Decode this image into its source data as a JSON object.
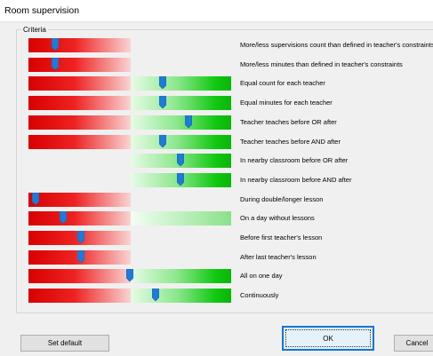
{
  "window": {
    "title": "Room supervision"
  },
  "criteria_group": {
    "label": "Criteria"
  },
  "colors": {
    "thumb": "#1e7bd8",
    "ok_border": "#0078d7"
  },
  "criteria": [
    {
      "label": "More/less supervisions count than defined in teacher's constraints",
      "value": 0.12,
      "has_red": true,
      "has_green": false
    },
    {
      "label": "More/less minutes than defined in teacher's constraints",
      "value": 0.12,
      "has_red": true,
      "has_green": false
    },
    {
      "label": "Equal count for each teacher",
      "value": 0.67,
      "has_red": true,
      "has_green": true
    },
    {
      "label": "Equal minutes for each teacher",
      "value": 0.67,
      "has_red": true,
      "has_green": true
    },
    {
      "label": "Teacher teaches before OR after",
      "value": 0.8,
      "has_red": true,
      "has_green": true
    },
    {
      "label": "Teacher teaches before AND after",
      "value": 0.67,
      "has_red": true,
      "has_green": true
    },
    {
      "label": "In nearby classroom before OR after",
      "value": 0.76,
      "has_red": false,
      "has_green": true
    },
    {
      "label": "In nearby classroom before AND after",
      "value": 0.76,
      "has_red": false,
      "has_green": true
    },
    {
      "label": "During double/longer lesson",
      "value": 0.02,
      "has_red": true,
      "has_green": false
    },
    {
      "label": "On a day without lessons",
      "value": 0.16,
      "has_red": true,
      "has_green": true,
      "green_dim": true
    },
    {
      "label": "Before first teacher's lesson",
      "value": 0.25,
      "has_red": true,
      "has_green": false
    },
    {
      "label": "After last teacher's lesson",
      "value": 0.25,
      "has_red": true,
      "has_green": false
    },
    {
      "label": "All on one day",
      "value": 0.5,
      "has_red": true,
      "has_green": true
    },
    {
      "label": "Continuously",
      "value": 0.63,
      "has_red": true,
      "has_green": true
    }
  ],
  "buttons": {
    "set_default": "Set default",
    "ok": "OK",
    "cancel": "Cancel"
  }
}
